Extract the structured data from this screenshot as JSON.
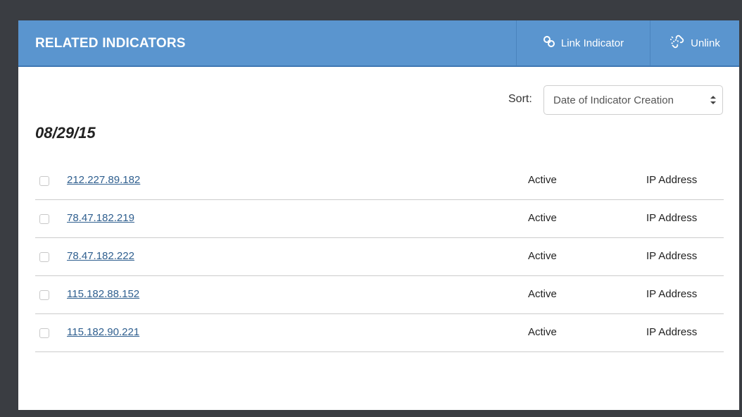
{
  "header": {
    "title": "RELATED INDICATORS",
    "link_label": "Link Indicator",
    "unlink_label": "Unlink",
    "link_icon": "link-icon",
    "unlink_icon": "unlink-icon"
  },
  "sort": {
    "label": "Sort:",
    "selected": "Date of Indicator Creation",
    "arrows_icon": "sort-arrows-icon"
  },
  "group": {
    "date": "08/29/15"
  },
  "indicators": [
    {
      "value": "212.227.89.182",
      "status": "Active",
      "type": "IP Address",
      "checked": false
    },
    {
      "value": "78.47.182.219",
      "status": "Active",
      "type": "IP Address",
      "checked": false
    },
    {
      "value": "78.47.182.222",
      "status": "Active",
      "type": "IP Address",
      "checked": false
    },
    {
      "value": "115.182.88.152",
      "status": "Active",
      "type": "IP Address",
      "checked": false
    },
    {
      "value": "115.182.90.221",
      "status": "Active",
      "type": "IP Address",
      "checked": false
    }
  ],
  "colors": {
    "header_bg": "#5a95cf",
    "link_text": "#2f5f8f",
    "page_bg": "#3a3d42"
  }
}
